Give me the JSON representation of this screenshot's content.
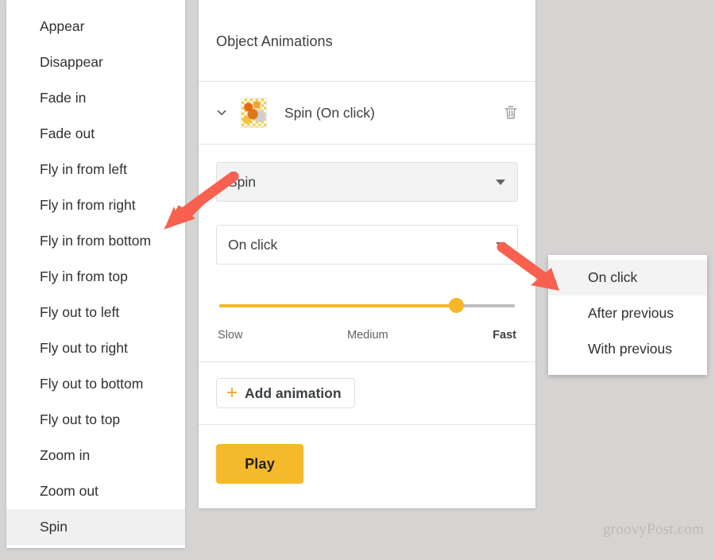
{
  "colors": {
    "page_background": "#d6d3d3",
    "panel_background": "#ffffff",
    "accent_amber": "#f5b92c",
    "slider_fill": "#f5b728",
    "arrow_red": "#f9604f",
    "selected_row": "#f0f0f0",
    "text_primary": "#3c4043",
    "text_secondary": "#5f6368"
  },
  "animation_type_list": {
    "name": "animation-type-list",
    "items": [
      {
        "label": "Appear",
        "selected": false
      },
      {
        "label": "Disappear",
        "selected": false
      },
      {
        "label": "Fade in",
        "selected": false
      },
      {
        "label": "Fade out",
        "selected": false
      },
      {
        "label": "Fly in from left",
        "selected": false
      },
      {
        "label": "Fly in from right",
        "selected": false
      },
      {
        "label": "Fly in from bottom",
        "selected": false
      },
      {
        "label": "Fly in from top",
        "selected": false
      },
      {
        "label": "Fly out to left",
        "selected": false
      },
      {
        "label": "Fly out to right",
        "selected": false
      },
      {
        "label": "Fly out to bottom",
        "selected": false
      },
      {
        "label": "Fly out to top",
        "selected": false
      },
      {
        "label": "Zoom in",
        "selected": false
      },
      {
        "label": "Zoom out",
        "selected": false
      },
      {
        "label": "Spin",
        "selected": true
      }
    ]
  },
  "object_animations_panel": {
    "title": "Object Animations",
    "animation_row": {
      "expand_icon": "chevron-down-icon",
      "thumbnail": "slide-object-thumbnail",
      "label": "Spin  (On click)",
      "delete_icon": "trash-icon"
    },
    "animation_type_select": {
      "value": "Spin",
      "caret_icon": "chevron-down-icon"
    },
    "animation_trigger_select": {
      "value": "On click",
      "caret_icon": "chevron-down-icon"
    },
    "speed_slider": {
      "value_percent": 80,
      "label_slow": "Slow",
      "label_medium": "Medium",
      "label_fast": "Fast"
    },
    "add_animation_button": {
      "plus_icon": "plus-icon",
      "label": "Add animation"
    },
    "play_button": {
      "label": "Play"
    }
  },
  "trigger_dropdown_menu": {
    "items": [
      {
        "label": "On click",
        "selected": true
      },
      {
        "label": "After previous",
        "selected": false
      },
      {
        "label": "With previous",
        "selected": false
      }
    ]
  },
  "watermark": {
    "text": "groovyPost.com"
  }
}
